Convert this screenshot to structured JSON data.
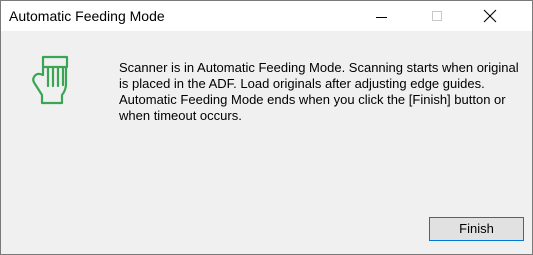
{
  "window": {
    "title": "Automatic Feeding Mode",
    "controls": {
      "minimize_icon": "minimize-icon",
      "maximize_icon": "maximize-icon",
      "close_icon": "close-icon"
    }
  },
  "dialog": {
    "icon": "hand-feeding-icon",
    "icon_color": "#3aa655",
    "message": "Scanner is in Automatic Feeding Mode. Scanning starts when original is placed in the ADF. Load originals after adjusting edge guides. Automatic Feeding Mode ends when you click the [Finish] button or when timeout occurs.",
    "finish_label": "Finish"
  },
  "colors": {
    "titlebar_bg": "#ffffff",
    "dialog_bg": "#f0f0f0",
    "button_bg": "#e1e1e1",
    "button_focus_border": "#0078d7",
    "icon_green": "#3aa655"
  }
}
